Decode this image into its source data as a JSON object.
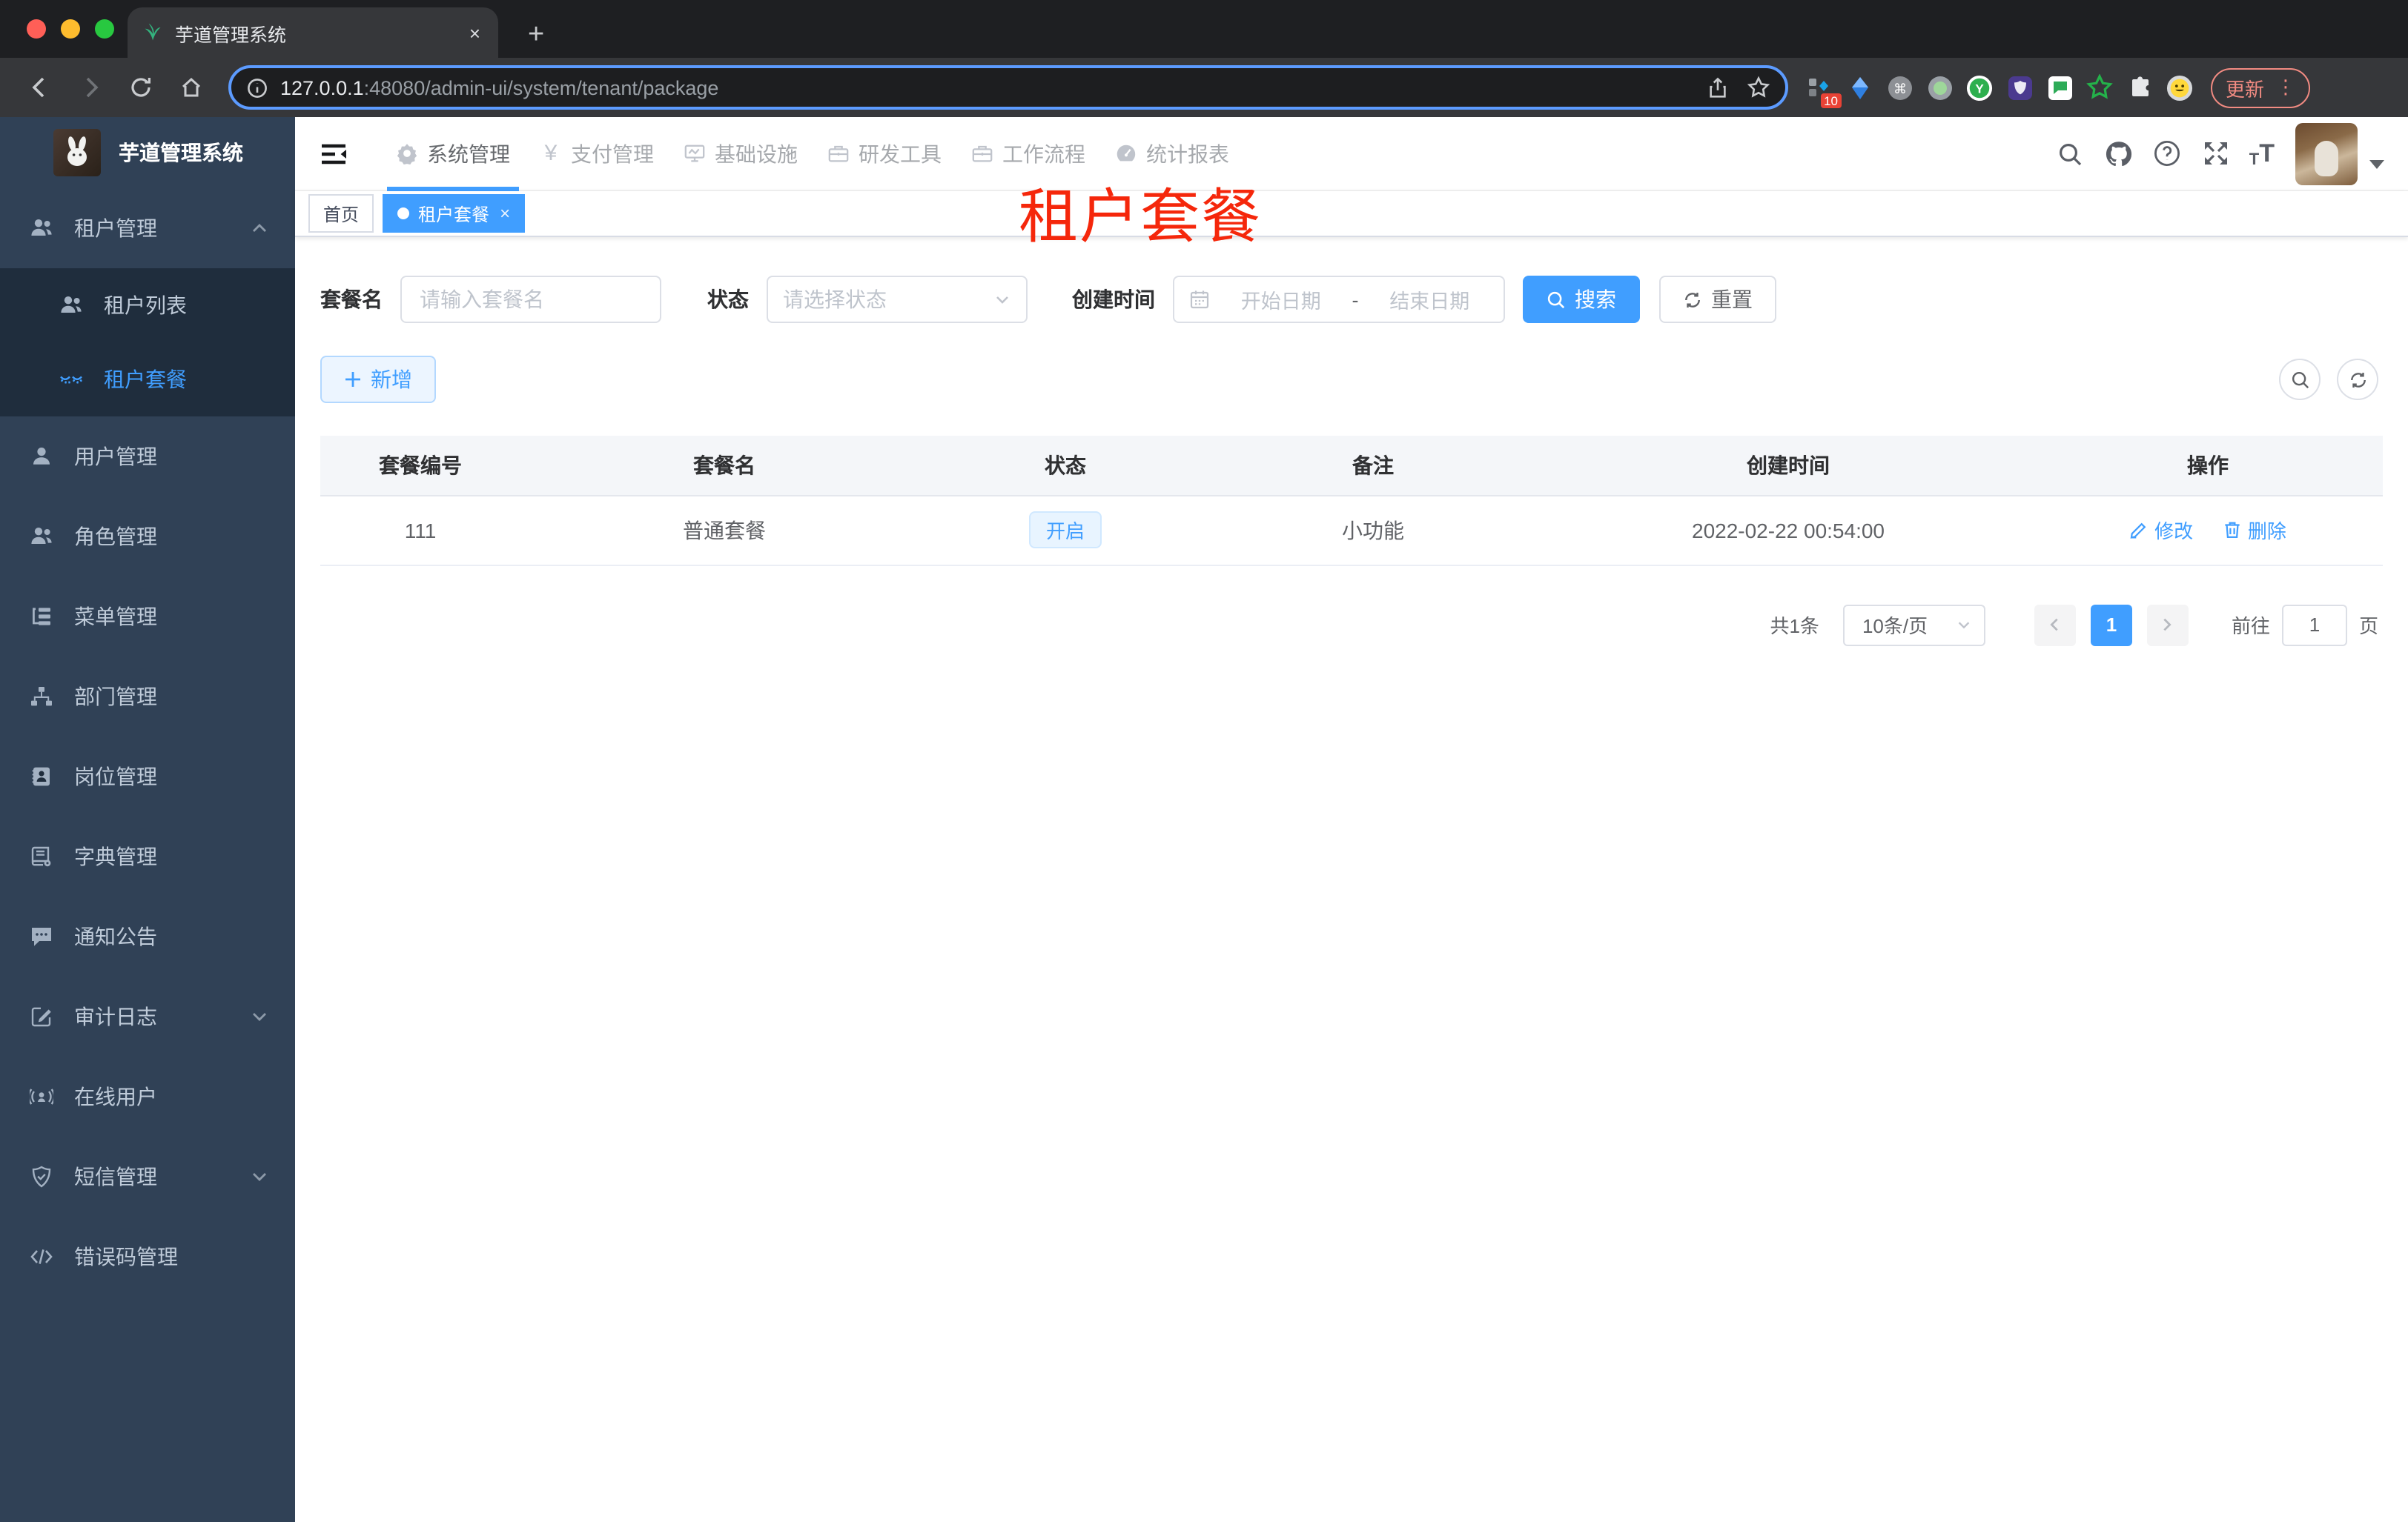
{
  "browser": {
    "tab_title": "芋道管理系统",
    "tab_close_glyph": "×",
    "new_tab_glyph": "+",
    "url_host": "127.0.0.1",
    "url_path": ":48080/admin-ui/system/tenant/package",
    "extension_badge": "10",
    "update_label": "更新",
    "kebab_glyph": "⋮"
  },
  "sidebar": {
    "logo_title": "芋道管理系统",
    "items": [
      {
        "label": "租户管理"
      },
      {
        "label": "租户列表"
      },
      {
        "label": "租户套餐"
      },
      {
        "label": "用户管理"
      },
      {
        "label": "角色管理"
      },
      {
        "label": "菜单管理"
      },
      {
        "label": "部门管理"
      },
      {
        "label": "岗位管理"
      },
      {
        "label": "字典管理"
      },
      {
        "label": "通知公告"
      },
      {
        "label": "审计日志"
      },
      {
        "label": "在线用户"
      },
      {
        "label": "短信管理"
      },
      {
        "label": "错误码管理"
      }
    ]
  },
  "topnav": {
    "items": [
      {
        "label": "系统管理"
      },
      {
        "label": "支付管理",
        "glyph": "¥"
      },
      {
        "label": "基础设施"
      },
      {
        "label": "研发工具"
      },
      {
        "label": "工作流程"
      },
      {
        "label": "统计报表"
      }
    ],
    "help_glyph": "?",
    "font_small": "T",
    "font_big": "T"
  },
  "tags": {
    "home": "首页",
    "active": "租户套餐",
    "close_glyph": "×"
  },
  "overlay_title": "租户套餐",
  "filters": {
    "name_label": "套餐名",
    "name_placeholder": "请输入套餐名",
    "status_label": "状态",
    "status_placeholder": "请选择状态",
    "date_label": "创建时间",
    "date_start": "开始日期",
    "date_sep": "-",
    "date_end": "结束日期",
    "search_label": "搜索",
    "reset_label": "重置"
  },
  "toolbar": {
    "add_label": "新增"
  },
  "table": {
    "headers": [
      "套餐编号",
      "套餐名",
      "状态",
      "备注",
      "创建时间",
      "操作"
    ],
    "rows": [
      {
        "id": "111",
        "name": "普通套餐",
        "status": "开启",
        "remark": "小功能",
        "created": "2022-02-22 00:54:00",
        "edit_label": "修改",
        "delete_label": "删除"
      }
    ]
  },
  "pagination": {
    "total": "共1条",
    "size": "10条/页",
    "page": "1",
    "goto_label": "前往",
    "goto_value": "1",
    "unit_label": "页"
  },
  "colors": {
    "accent": "#409eff",
    "sidebar_bg": "#304156",
    "submenu_bg": "#1f2d3d",
    "overlay_red": "#f5270b",
    "status_tag_bg": "#e8f4ff"
  }
}
